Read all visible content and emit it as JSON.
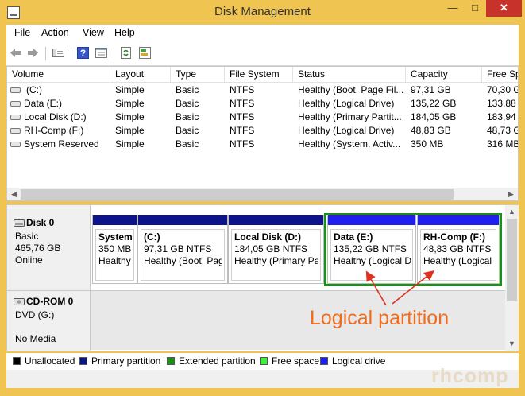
{
  "window": {
    "title": "Disk Management",
    "min": "—",
    "max": "□",
    "close": "✕"
  },
  "menu": [
    "File",
    "Action",
    "View",
    "Help"
  ],
  "toolbar_icons": [
    "back-arrow-icon",
    "forward-arrow-icon",
    "console-tree-icon",
    "help-icon",
    "properties-icon",
    "refresh-icon",
    "rescan-disks-icon"
  ],
  "volume_table": {
    "columns": [
      "Volume",
      "Layout",
      "Type",
      "File System",
      "Status",
      "Capacity",
      "Free Sp"
    ],
    "rows": [
      [
        "(C:)",
        "Simple",
        "Basic",
        "NTFS",
        "Healthy (Boot, Page Fil...",
        "97,31 GB",
        "70,30 G"
      ],
      [
        "Data (E:)",
        "Simple",
        "Basic",
        "NTFS",
        "Healthy (Logical Drive)",
        "135,22 GB",
        "133,88 G"
      ],
      [
        "Local Disk (D:)",
        "Simple",
        "Basic",
        "NTFS",
        "Healthy (Primary Partit...",
        "184,05 GB",
        "183,94 G"
      ],
      [
        "RH-Comp (F:)",
        "Simple",
        "Basic",
        "NTFS",
        "Healthy (Logical Drive)",
        "48,83 GB",
        "48,73 G"
      ],
      [
        "System Reserved",
        "Simple",
        "Basic",
        "NTFS",
        "Healthy (System, Activ...",
        "350 MB",
        "316 MB"
      ]
    ]
  },
  "disks": [
    {
      "name": "Disk 0",
      "type": "Basic",
      "size": "465,76 GB",
      "state": "Online",
      "partitions": [
        {
          "name": "System",
          "size": "350 MB",
          "status": "Healthy",
          "bar_color": "#0d138a"
        },
        {
          "name": "(C:)",
          "size": "97,31 GB NTFS",
          "status": "Healthy (Boot, Pag",
          "bar_color": "#0d138a"
        },
        {
          "name": "Local Disk  (D:)",
          "size": "184,05 GB NTFS",
          "status": "Healthy (Primary Pa",
          "bar_color": "#0d138a"
        },
        {
          "name": "Data  (E:)",
          "size": "135,22 GB NTFS",
          "status": "Healthy (Logical D",
          "bar_color": "#1f1ff2"
        },
        {
          "name": "RH-Comp  (F:)",
          "size": "48,83 GB NTFS",
          "status": "Healthy (Logical",
          "bar_color": "#1f1ff2"
        }
      ],
      "extended_border_color": "#1b8f1b"
    },
    {
      "name": "CD-ROM 0",
      "type": "DVD (G:)",
      "state": "No Media"
    }
  ],
  "legend": [
    {
      "label": "Unallocated",
      "color": "#000000"
    },
    {
      "label": "Primary partition",
      "color": "#0d138a"
    },
    {
      "label": "Extended partition",
      "color": "#1b8f1b"
    },
    {
      "label": "Free space",
      "color": "#3df03d"
    },
    {
      "label": "Logical drive",
      "color": "#1f1ff2"
    }
  ],
  "annotation": {
    "text": "Logical partition",
    "color": "#f06c1b"
  },
  "watermark": "rhcomp"
}
